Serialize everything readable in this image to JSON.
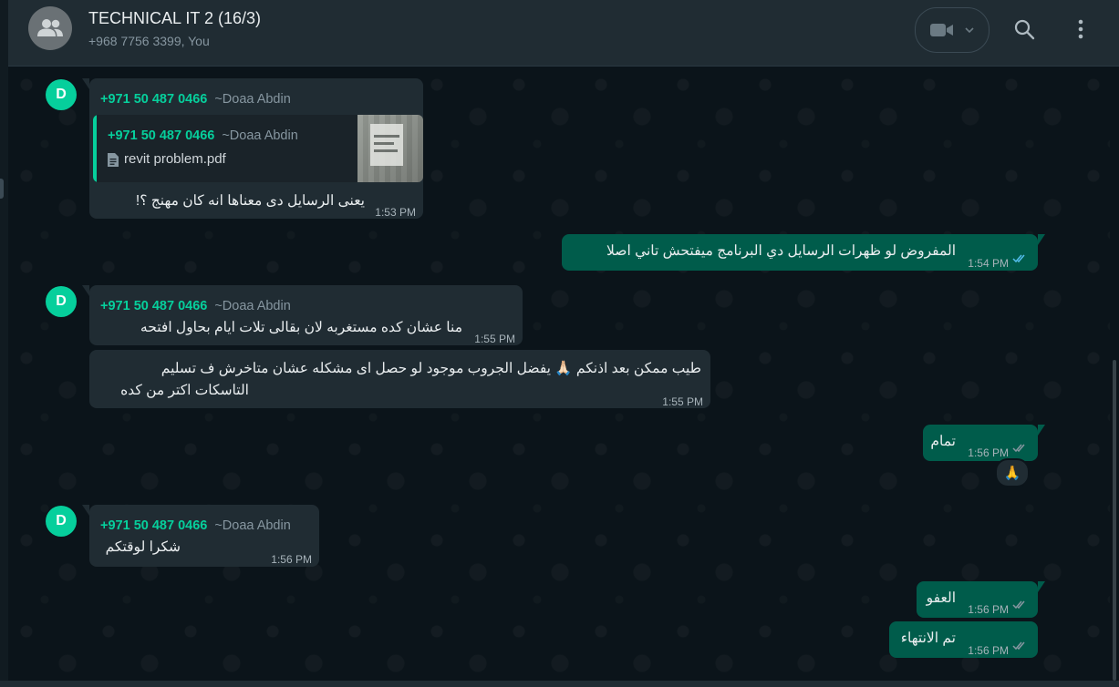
{
  "header": {
    "title": "TECHNICAL IT 2 (16/3)",
    "subtitle": "+968 7756 3399, You"
  },
  "messages": [
    {
      "direction": "incoming",
      "avatar_letter": "D",
      "sender_phone": "+971 50 487 0466",
      "sender_name": "~Doaa Abdin",
      "quoted": {
        "sender_phone": "+971 50 487 0466",
        "sender_name": "~Doaa Abdin",
        "file_name": "revit problem.pdf"
      },
      "text": "يعنى الرسايل دى معناها انه كان مهنج ؟!",
      "time": "1:53 PM"
    },
    {
      "direction": "outgoing",
      "text": "المفروض لو ظهرات الرسايل دي البرنامج ميفتحش تاني اصلا",
      "time": "1:54 PM",
      "status": "read"
    },
    {
      "direction": "incoming",
      "avatar_letter": "D",
      "sender_phone": "+971 50 487 0466",
      "sender_name": "~Doaa Abdin",
      "text": "منا عشان كده مستغربه لان بقالى تلات ايام بحاول افتحه",
      "time": "1:55 PM"
    },
    {
      "direction": "incoming",
      "text_line1": "طيب ممكن بعد اذنكم 🙏🏻 يفضل الجروب موجود لو حصل اى مشكله عشان متاخرش ف تسليم",
      "text_line2": "التاسكات اكتر من كده",
      "time": "1:55 PM"
    },
    {
      "direction": "outgoing",
      "text": "تمام",
      "time": "1:56 PM",
      "status": "delivered",
      "reaction": "🙏"
    },
    {
      "direction": "incoming",
      "avatar_letter": "D",
      "sender_phone": "+971 50 487 0466",
      "sender_name": "~Doaa Abdin",
      "text": "شكرا لوقتكم",
      "time": "1:56 PM"
    },
    {
      "direction": "outgoing",
      "text": "العفو",
      "time": "1:56 PM",
      "status": "delivered"
    },
    {
      "direction": "outgoing",
      "text": "تم الانتهاء",
      "time": "1:56 PM",
      "status": "delivered"
    }
  ],
  "colors": {
    "background": "#0b141a",
    "incoming_bubble": "#202c33",
    "outgoing_bubble": "#005c4b",
    "accent": "#06cf9c",
    "read_ticks": "#53bdeb"
  },
  "icons": {
    "group_avatar": "group-icon",
    "video_call": "video-camera-icon",
    "dropdown": "chevron-down-icon",
    "search": "search-icon",
    "menu": "more-vertical-icon",
    "file": "document-icon",
    "ticks": "double-check-icon"
  }
}
